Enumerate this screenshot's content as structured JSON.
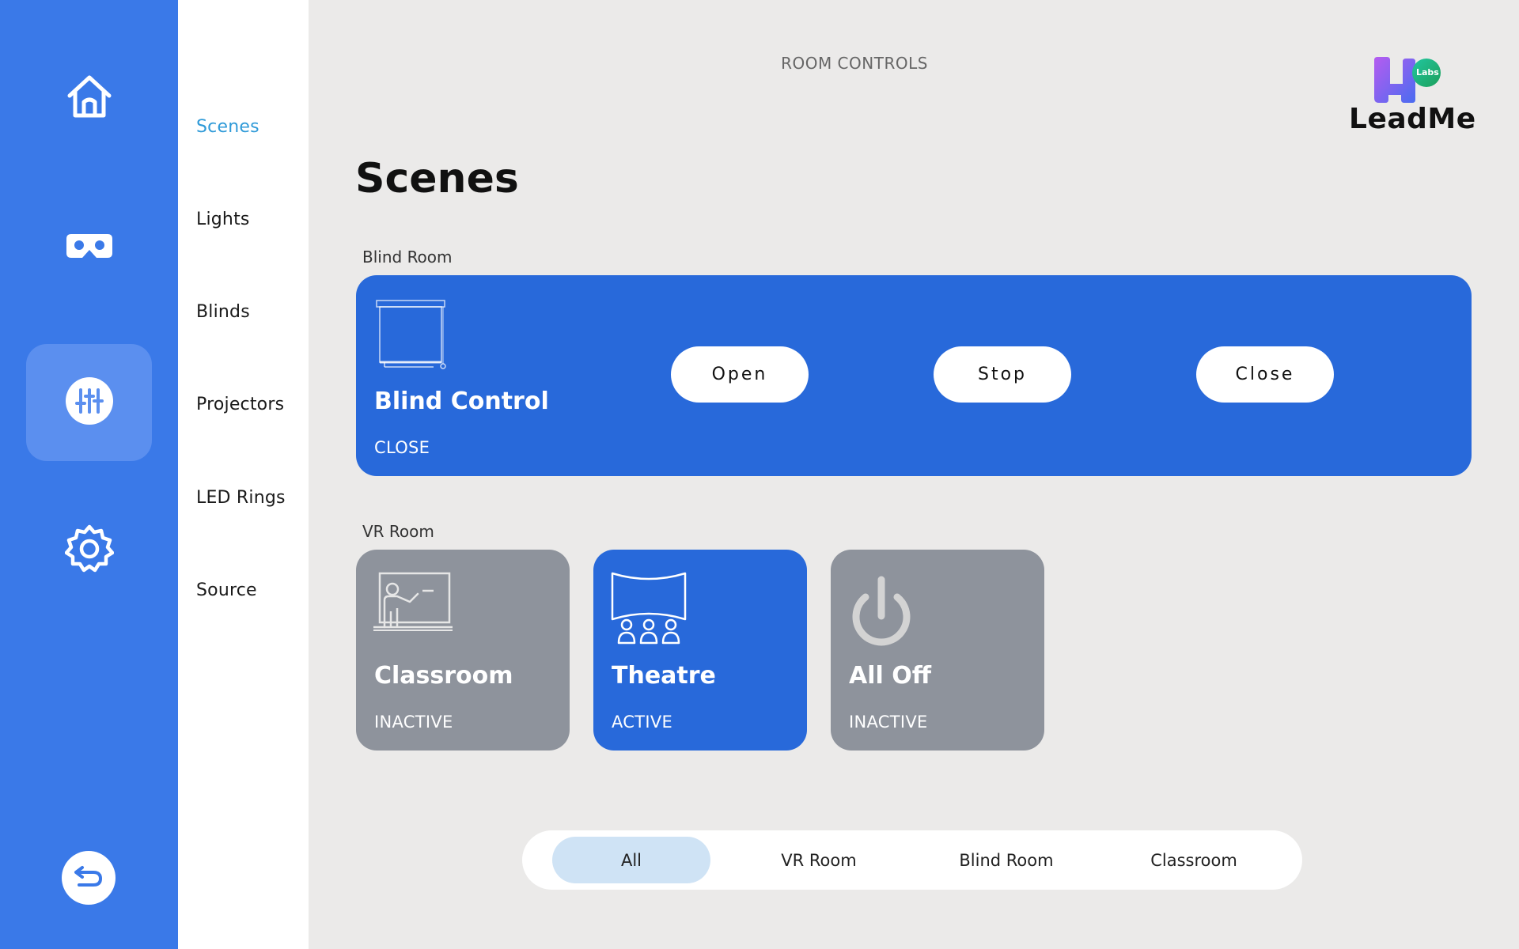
{
  "header": {
    "title": "ROOM CONTROLS",
    "logo": {
      "text": "LeadMe",
      "badge": "Labs"
    }
  },
  "rail": {
    "items": [
      {
        "icon": "home-icon",
        "active": false
      },
      {
        "icon": "vr-headset-icon",
        "active": false
      },
      {
        "icon": "sliders-icon",
        "active": true
      },
      {
        "icon": "gear-icon",
        "active": false
      }
    ],
    "back_icon": "back-icon"
  },
  "subnav": {
    "items": [
      "Scenes",
      "Lights",
      "Blinds",
      "Projectors",
      "LED Rings",
      "Source"
    ],
    "active": "Scenes"
  },
  "page": {
    "title": "Scenes"
  },
  "blind_room": {
    "label": "Blind Room",
    "card": {
      "title": "Blind Control",
      "status": "CLOSE",
      "icon": "blind-icon",
      "buttons": {
        "open": "Open",
        "stop": "Stop",
        "close": "Close"
      }
    }
  },
  "vr_room": {
    "label": "VR Room",
    "scenes": [
      {
        "title": "Classroom",
        "status": "INACTIVE",
        "icon": "classroom-icon",
        "active": false
      },
      {
        "title": "Theatre",
        "status": "ACTIVE",
        "icon": "theatre-icon",
        "active": true
      },
      {
        "title": "All Off",
        "status": "INACTIVE",
        "icon": "power-icon",
        "active": false
      }
    ]
  },
  "filters": {
    "tabs": [
      "All",
      "VR Room",
      "Blind Room",
      "Classroom"
    ],
    "active": "All"
  },
  "colors": {
    "rail": "#3a79e8",
    "card_active": "#2869da",
    "card_inactive": "#8e939c",
    "subnav_active": "#2f9ad8",
    "background": "#ebeae9"
  }
}
